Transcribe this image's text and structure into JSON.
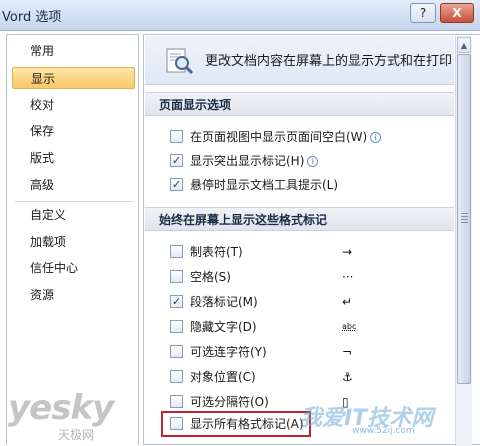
{
  "window": {
    "title": "Vord 选项",
    "help_label": "?",
    "close_label": "X"
  },
  "nav": {
    "items": [
      {
        "label": "常用",
        "active": false
      },
      {
        "label": "显示",
        "active": true
      },
      {
        "label": "校对",
        "active": false
      },
      {
        "label": "保存",
        "active": false
      },
      {
        "label": "版式",
        "active": false
      },
      {
        "label": "高级",
        "active": false
      },
      {
        "label": "自定义",
        "active": false
      },
      {
        "label": "加载项",
        "active": false
      },
      {
        "label": "信任中心",
        "active": false
      },
      {
        "label": "资源",
        "active": false
      }
    ]
  },
  "banner": {
    "text": "更改文档内容在屏幕上的显示方式和在打印"
  },
  "section1": {
    "title": "页面显示选项",
    "options": [
      {
        "label": "在页面视图中显示页面间空白(W)",
        "checked": false,
        "info": true
      },
      {
        "label": "显示突出显示标记(H)",
        "checked": true,
        "info": true
      },
      {
        "label": "悬停时显示文档工具提示(L)",
        "checked": true,
        "info": false
      }
    ]
  },
  "section2": {
    "title": "始终在屏幕上显示这些格式标记",
    "options": [
      {
        "label": "制表符(T)",
        "checked": false,
        "mark": "→"
      },
      {
        "label": "空格(S)",
        "checked": false,
        "mark": "···"
      },
      {
        "label": "段落标记(M)",
        "checked": true,
        "mark": "↵"
      },
      {
        "label": "隐藏文字(D)",
        "checked": false,
        "mark": "abc"
      },
      {
        "label": "可选连字符(Y)",
        "checked": false,
        "mark": "¬"
      },
      {
        "label": "对象位置(C)",
        "checked": false,
        "mark": "⚓"
      },
      {
        "label": "可选分隔符(O)",
        "checked": false,
        "mark": "▯"
      },
      {
        "label": "显示所有格式标记(A)",
        "checked": false,
        "mark": ""
      }
    ]
  },
  "watermarks": {
    "left": "yesky",
    "left_sub": "天极网",
    "right": "我爱IT技术网",
    "right_url": "www.52ij.com"
  },
  "icons": {
    "banner": "magnifier-document-icon",
    "info": "info-icon",
    "check": "checkmark-icon"
  },
  "colors": {
    "active_nav": "#f9c867",
    "highlight_box": "#c0262d",
    "title_bar": "#c6d6ee"
  }
}
